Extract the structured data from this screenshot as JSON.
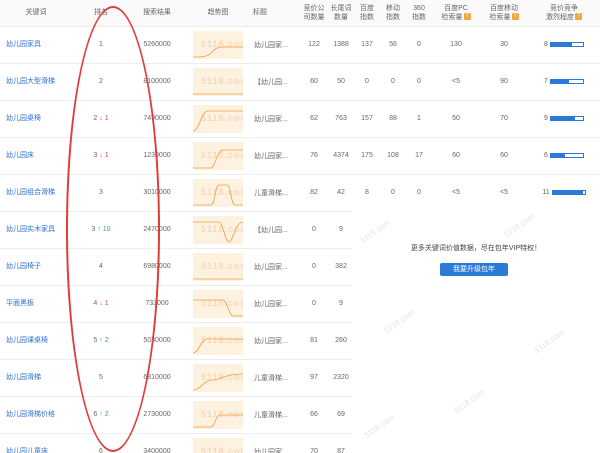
{
  "headers": {
    "keyword": "关键词",
    "rank": "排名",
    "results": "搜索结果",
    "trend": "趋势图",
    "title": "标题",
    "bid_companies": "竞价公\n司数量",
    "long_tail": "长尾词\n数量",
    "baidu_index": "百度\n指数",
    "mobile_index": "移动\n指数",
    "index_360": "360\n指数",
    "baidu_pc": "百度PC\n检索量",
    "baidu_mobile": "百度移动\n检索量",
    "competition": "竞价竞争\n激烈程度"
  },
  "badge_glyph": "?",
  "trend_watermark": "5118.com",
  "rows": [
    {
      "keyword": "幼儿园家具",
      "rank": "1",
      "change": "",
      "dir": "",
      "results": "5260000",
      "title": "幼儿园家...",
      "bid": "122",
      "long_tail": "1388",
      "baidu": "137",
      "mobile": "56",
      "i360": "0",
      "pc": "130",
      "mob": "30",
      "comp": "8",
      "comp_level": 0.65
    },
    {
      "keyword": "幼儿园大型滑梯",
      "rank": "2",
      "change": "",
      "dir": "",
      "results": "8100000",
      "title": "【幼儿园...",
      "bid": "60",
      "long_tail": "50",
      "baidu": "0",
      "mobile": "0",
      "i360": "0",
      "pc": "<5",
      "mob": "90",
      "comp": "7",
      "comp_level": 0.55
    },
    {
      "keyword": "幼儿园桌椅",
      "rank": "2",
      "change": "1",
      "dir": "down",
      "results": "7490000",
      "title": "幼儿园家...",
      "bid": "62",
      "long_tail": "763",
      "baidu": "157",
      "mobile": "88",
      "i360": "1",
      "pc": "50",
      "mob": "70",
      "comp": "9",
      "comp_level": 0.75
    },
    {
      "keyword": "幼儿园床",
      "rank": "3",
      "change": "1",
      "dir": "down",
      "results": "1230000",
      "title": "幼儿园家...",
      "bid": "76",
      "long_tail": "4374",
      "baidu": "175",
      "mobile": "108",
      "i360": "17",
      "pc": "60",
      "mob": "60",
      "comp": "6",
      "comp_level": 0.45
    },
    {
      "keyword": "幼儿园组合滑梯",
      "rank": "3",
      "change": "",
      "dir": "",
      "results": "3010000",
      "title": "儿童滑梯...",
      "bid": "82",
      "long_tail": "42",
      "baidu": "8",
      "mobile": "0",
      "i360": "0",
      "pc": "<5",
      "mob": "<5",
      "comp": "11",
      "comp_level": 0.95
    },
    {
      "keyword": "幼儿园实木家具",
      "rank": "3",
      "change": "10",
      "dir": "up",
      "results": "2470000",
      "title": "【幼儿园...",
      "bid": "0",
      "long_tail": "9"
    },
    {
      "keyword": "幼儿园椅子",
      "rank": "4",
      "change": "",
      "dir": "",
      "results": "6980000",
      "title": "幼儿园家...",
      "bid": "0",
      "long_tail": "382"
    },
    {
      "keyword": "平面黑板",
      "rank": "4",
      "change": "1",
      "dir": "down",
      "results": "733000",
      "title": "幼儿园家...",
      "bid": "0",
      "long_tail": "9"
    },
    {
      "keyword": "幼儿园课桌椅",
      "rank": "5",
      "change": "2",
      "dir": "up",
      "results": "5030000",
      "title": "幼儿园家...",
      "bid": "81",
      "long_tail": "260"
    },
    {
      "keyword": "幼儿园滑梯",
      "rank": "5",
      "change": "",
      "dir": "",
      "results": "6810000",
      "title": "儿童滑梯...",
      "bid": "97",
      "long_tail": "2320"
    },
    {
      "keyword": "幼儿园滑梯价格",
      "rank": "6",
      "change": "2",
      "dir": "up",
      "results": "2730000",
      "title": "儿童滑梯...",
      "bid": "66",
      "long_tail": "69"
    },
    {
      "keyword": "幼儿园儿童床",
      "rank": "6",
      "change": "",
      "dir": "",
      "results": "3400000",
      "title": "幼儿园家...",
      "bid": "70",
      "long_tail": "87"
    }
  ],
  "vip": {
    "message": "更多关键词价值数据，尽在包年VIP特权！",
    "button": "我要升级包年"
  }
}
